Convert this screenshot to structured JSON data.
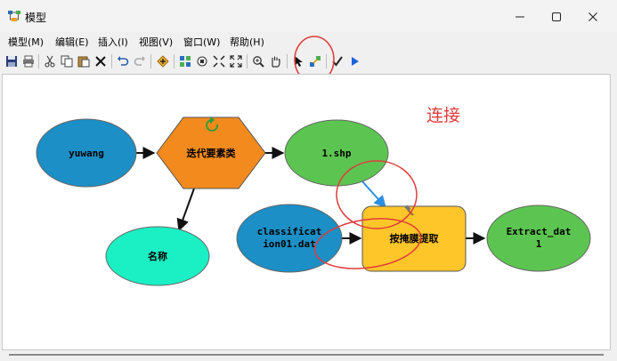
{
  "window": {
    "title": "模型",
    "icon": "model-builder-icon",
    "controls": [
      "minimize-icon",
      "maximize-icon",
      "close-icon"
    ]
  },
  "menu": [
    "模型(M)",
    "编辑(E)",
    "插入(I)",
    "视图(V)",
    "窗口(W)",
    "帮助(H)"
  ],
  "toolbar": {
    "buttons": [
      "save-icon",
      "print-icon",
      "cut-icon",
      "copy-icon",
      "paste-icon",
      "delete-icon",
      "undo-icon",
      "redo-icon",
      "add-data-icon",
      "auto-layout-icon",
      "full-extent-icon",
      "fixed-zoom-in-icon",
      "fixed-zoom-out-icon",
      "zoom-in-icon",
      "pan-icon",
      "select-icon",
      "connect-icon",
      "validate-icon",
      "run-icon"
    ]
  },
  "model": {
    "nodes": {
      "yuwang": "yuwang",
      "iterator": "迭代要素类",
      "mingcheng": "名称",
      "shp": "1.shp",
      "classification": [
        "classificat",
        "ion01.dat"
      ],
      "extract_tool": "按掩膜提取",
      "output": [
        "Extract_dat",
        "1"
      ]
    }
  },
  "annotation": "连接",
  "colors": {
    "input_blue": "#1b8fc6",
    "tool_orange": "#f28a1e",
    "output_green": "#5cc551",
    "name_cyan": "#1af0c4",
    "tool_yellow": "#ffc629",
    "annotation_red": "#e03b3b",
    "connector_blue": "#2a8fe0"
  }
}
